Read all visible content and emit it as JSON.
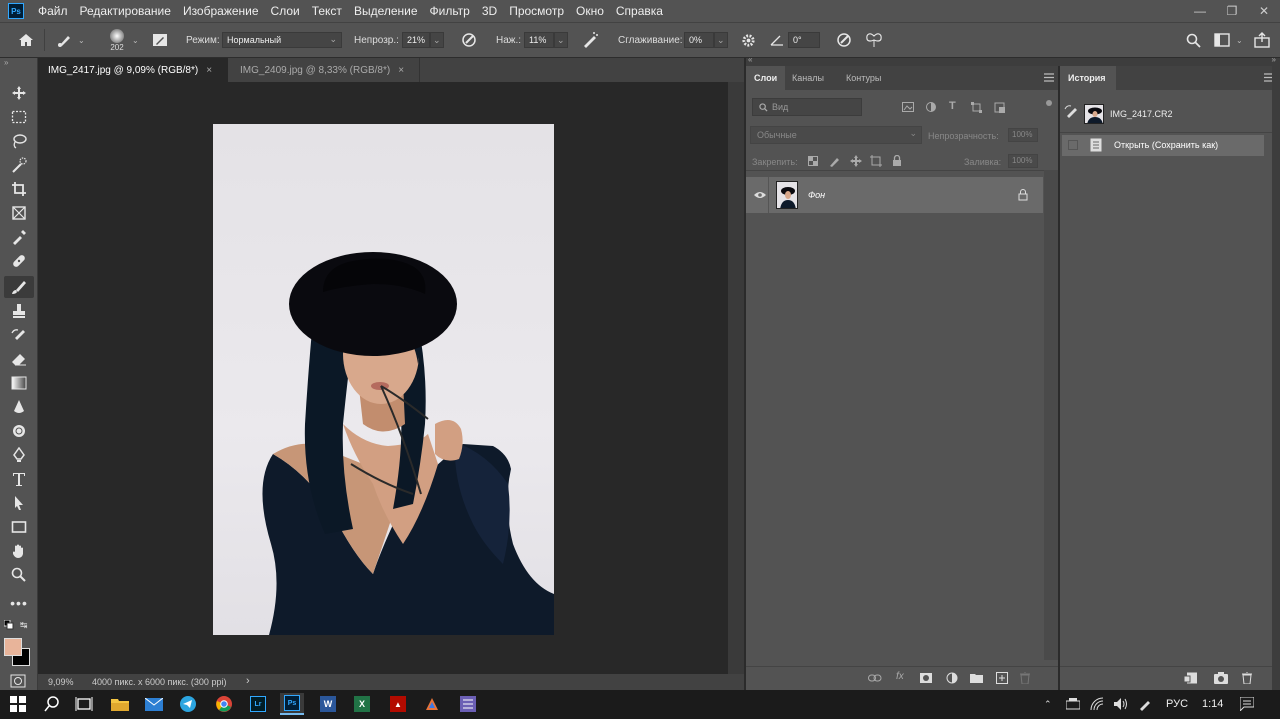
{
  "app": {
    "logo": "Ps"
  },
  "menu": [
    "Файл",
    "Редактирование",
    "Изображение",
    "Слои",
    "Текст",
    "Выделение",
    "Фильтр",
    "3D",
    "Просмотр",
    "Окно",
    "Справка"
  ],
  "options": {
    "brush_size": "202",
    "mode_label": "Режим:",
    "mode_value": "Нормальный",
    "opacity_label": "Непрозр.:",
    "opacity_value": "21%",
    "flow_label": "Наж.:",
    "flow_value": "11%",
    "smoothing_label": "Сглаживание:",
    "smoothing_value": "0%",
    "angle_value": "0°"
  },
  "tabs": [
    {
      "label": "IMG_2417.jpg @ 9,09% (RGB/8*)",
      "close": "×",
      "active": true
    },
    {
      "label": "IMG_2409.jpg @ 8,33% (RGB/8*)",
      "close": "×",
      "active": false
    }
  ],
  "status": {
    "zoom": "9,09%",
    "info": "4000 пикс. x 6000 пикс. (300 ppi)",
    "arrow": "›"
  },
  "colors": {
    "foreground": "#e8b49a",
    "background": "#000000",
    "accent": "#31a8ff"
  },
  "layers_panel": {
    "tabs": [
      "Слои",
      "Каналы",
      "Контуры"
    ],
    "search_placeholder": "Вид",
    "blend_mode": "Обычные",
    "opacity_label": "Непрозрачность:",
    "opacity_value": "100%",
    "lock_label": "Закрепить:",
    "fill_label": "Заливка:",
    "fill_value": "100%",
    "layer_name": "Фон"
  },
  "history_panel": {
    "title": "История",
    "snapshot_name": "IMG_2417.CR2",
    "items": [
      "Открыть (Сохранить как)"
    ]
  },
  "taskbar": {
    "language": "РУС",
    "time": "1:14"
  }
}
